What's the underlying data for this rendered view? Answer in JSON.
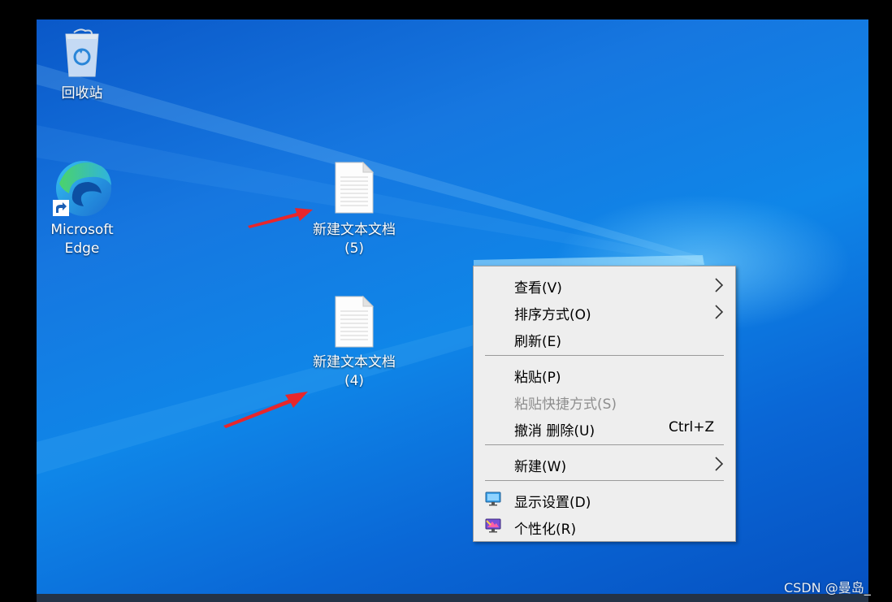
{
  "desktop": {
    "icons": [
      {
        "label_1": "回收站",
        "label_2": "",
        "icon": "recycle-bin-icon"
      },
      {
        "label_1": "Microsoft",
        "label_2": "Edge",
        "icon": "edge-icon"
      },
      {
        "label_1": "新建文本文档",
        "label_2": "(5)",
        "icon": "text-document-icon"
      },
      {
        "label_1": "新建文本文档",
        "label_2": "(4)",
        "icon": "text-document-icon"
      }
    ],
    "annotation_color": "#e8262b"
  },
  "context_menu": {
    "items": [
      {
        "label": "查看(V)",
        "submenu": true
      },
      {
        "label": "排序方式(O)",
        "submenu": true
      },
      {
        "label": "刷新(E)"
      },
      {
        "label": "粘贴(P)"
      },
      {
        "label": "粘贴快捷方式(S)",
        "disabled": true
      },
      {
        "label": "撤消 删除(U)",
        "shortcut": "Ctrl+Z"
      },
      {
        "label": "新建(W)",
        "submenu": true
      },
      {
        "label": "显示设置(D)",
        "icon": "display-settings-icon"
      },
      {
        "label": "个性化(R)",
        "icon": "personalize-icon"
      }
    ]
  },
  "watermark": "CSDN @曼岛_"
}
